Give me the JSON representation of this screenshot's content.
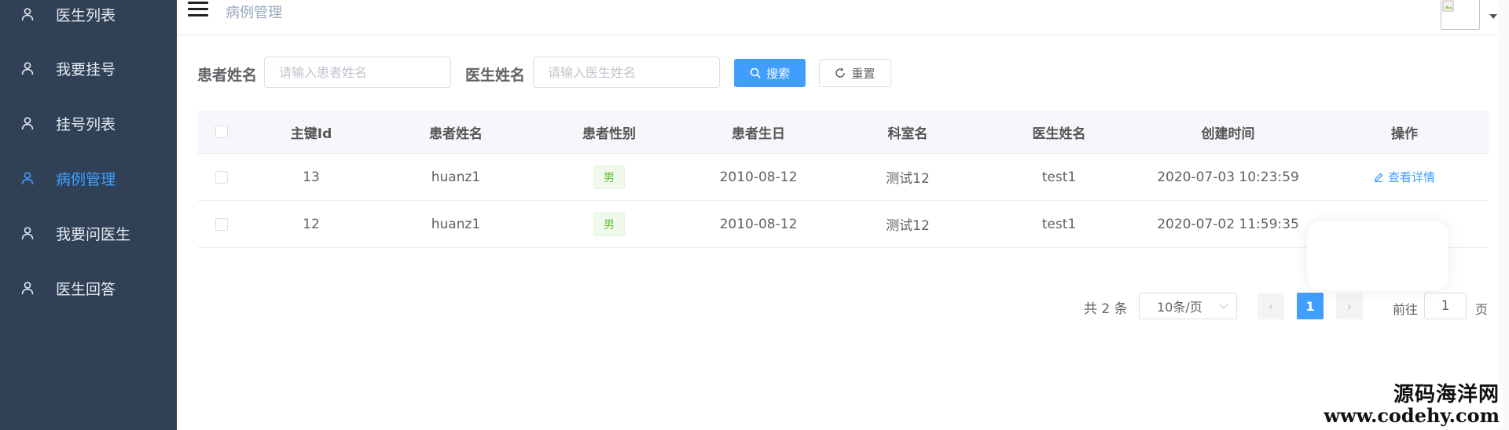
{
  "sidebar": {
    "items": [
      {
        "label": "医生列表",
        "icon": "user-icon",
        "active": false
      },
      {
        "label": "我要挂号",
        "icon": "user-icon",
        "active": false
      },
      {
        "label": "挂号列表",
        "icon": "user-icon",
        "active": false
      },
      {
        "label": "病例管理",
        "icon": "user-icon",
        "active": true
      },
      {
        "label": "我要问医生",
        "icon": "user-icon",
        "active": false
      },
      {
        "label": "医生回答",
        "icon": "user-icon",
        "active": false
      }
    ],
    "bg_color": "#304156",
    "active_color": "#409eff"
  },
  "header": {
    "breadcrumb": "病例管理",
    "menu_icon": "hamburger-icon",
    "avatar_icon": "broken-image-icon"
  },
  "search": {
    "patient_label": "患者姓名",
    "patient_placeholder": "请输入患者姓名",
    "patient_value": "",
    "doctor_label": "医生姓名",
    "doctor_placeholder": "请输入医生姓名",
    "doctor_value": "",
    "search_button": "搜索",
    "reset_button": "重置"
  },
  "table": {
    "columns": [
      "主键Id",
      "患者姓名",
      "患者性别",
      "患者生日",
      "科室名",
      "医生姓名",
      "创建时间",
      "操作"
    ],
    "rows": [
      {
        "id": "13",
        "patient": "huanz1",
        "gender": "男",
        "birthday": "2010-08-12",
        "dept": "测试12",
        "doctor": "test1",
        "created": "2020-07-03 10:23:59",
        "action": "查看详情"
      },
      {
        "id": "12",
        "patient": "huanz1",
        "gender": "男",
        "birthday": "2010-08-12",
        "dept": "测试12",
        "doctor": "test1",
        "created": "2020-07-02 11:59:35",
        "action": ""
      }
    ]
  },
  "pagination": {
    "total": "共 2 条",
    "page_size": "10条/页",
    "current_page": "1",
    "goto_label": "前往",
    "goto_value": "1",
    "page_suffix": "页"
  },
  "watermark": {
    "line1": "源码海洋网",
    "line2": "www.codehy.com"
  },
  "colors": {
    "primary": "#409eff",
    "tag_green": "#67c23a"
  }
}
